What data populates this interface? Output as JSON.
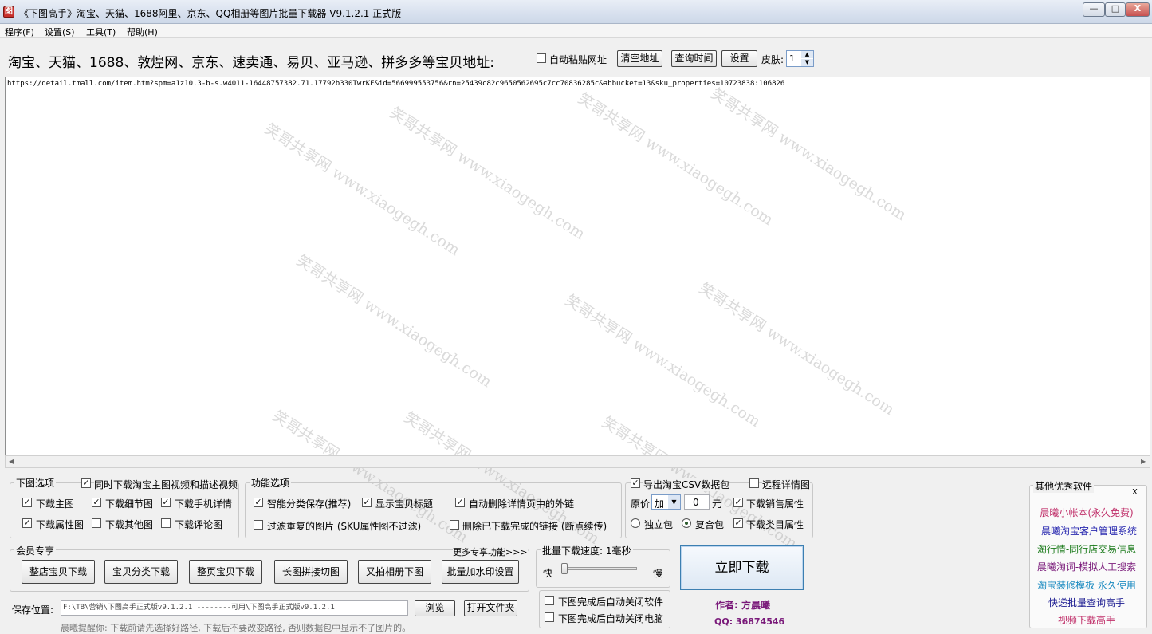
{
  "window": {
    "title": "《下图高手》淘宝、天猫、1688阿里、京东、QQ相册等图片批量下载器 V9.1.2.1 正式版",
    "icon_label": "图",
    "min": "—",
    "max": "□",
    "close": "X"
  },
  "menu": [
    "程序(F)",
    "设置(S)",
    "工具(T)",
    "帮助(H)"
  ],
  "toolbar": {
    "address_label": "淘宝、天猫、1688、敦煌网、京东、速卖通、易贝、亚马逊、拼多多等宝贝地址:",
    "auto_paste": "自动粘贴网址",
    "clear_btn": "清空地址",
    "query_time_btn": "查询时间",
    "settings_btn": "设置",
    "skin_label": "皮肤:",
    "skin_value": "1"
  },
  "url_text": "https://detail.tmall.com/item.htm?spm=a1z10.3-b-s.w4011-16448757382.71.17792b330TwrKF&id=566999553756&rn=25439c82c9650562695c7cc70836285c&abbucket=13&sku_properties=10723838:106826",
  "watermark": "笑哥共享网 www.xiaogegh.com",
  "download_options": {
    "title": "下图选项",
    "video_label": "同时下载淘宝主图视频和描述视频",
    "items": [
      {
        "label": "下载主图",
        "checked": true
      },
      {
        "label": "下载细节图",
        "checked": true
      },
      {
        "label": "下载手机详情",
        "checked": true
      },
      {
        "label": "下载属性图",
        "checked": true
      },
      {
        "label": "下载其他图",
        "checked": false
      },
      {
        "label": "下载评论图",
        "checked": false
      }
    ]
  },
  "features": {
    "title": "功能选项",
    "items": [
      {
        "label": "智能分类保存(推荐)",
        "checked": true
      },
      {
        "label": "显示宝贝标题",
        "checked": true
      },
      {
        "label": "自动删除详情页中的外链",
        "checked": true
      },
      {
        "label": "过滤重复的图片 (SKU属性图不过滤)",
        "checked": false
      },
      {
        "label": "删除已下载完成的链接 (断点续传)",
        "checked": false
      }
    ]
  },
  "csv": {
    "export_label": "导出淘宝CSV数据包",
    "remote_label": "远程详情图",
    "price_label": "原价",
    "price_op": "加",
    "price_value": "0",
    "unit": "元",
    "sales_attr": "下载销售属性",
    "pkg_single": "独立包",
    "pkg_combined": "复合包",
    "category_attr": "下载类目属性"
  },
  "vip": {
    "title": "会员专享",
    "more": "更多专享功能>>>",
    "buttons": [
      "整店宝贝下载",
      "宝贝分类下载",
      "整页宝贝下载",
      "长图拼接切图",
      "又拍相册下图",
      "批量加水印设置"
    ]
  },
  "speed": {
    "title": "批量下载速度: 1毫秒",
    "fast": "快",
    "slow": "慢",
    "slider_fraction": 0.0
  },
  "after": {
    "close_app": "下图完成后自动关闭软件",
    "shutdown": "下图完成后自动关闭电脑"
  },
  "download_btn": "立即下载",
  "author": {
    "name": "作者: 方晨曦",
    "qq": "QQ: 36874546"
  },
  "save": {
    "label": "保存位置:",
    "path": "F:\\TB\\营销\\下图高手正式版v9.1.2.1 --------可用\\下图高手正式版v9.1.2.1",
    "browse": "浏览",
    "open_folder": "打开文件夹",
    "hint": "晨曦提醒你: 下载前请先选择好路径, 下载后不要改变路径, 否则数据包中显示不了图片的。"
  },
  "other_software": {
    "title": "其他优秀软件",
    "close": "X",
    "items": [
      {
        "label": "晨曦小帐本(永久免费)",
        "color": "#c0306a"
      },
      {
        "label": "晨曦淘宝客户管理系统",
        "color": "#2a2ab0"
      },
      {
        "label": "淘行情-同行店交易信息",
        "color": "#1a7a1a"
      },
      {
        "label": "晨曦淘词-模拟人工搜索",
        "color": "#7a1a7a"
      },
      {
        "label": "淘宝装修模板 永久使用",
        "color": "#1a8ac0"
      },
      {
        "label": "快递批量查询高手",
        "color": "#1a1a90"
      },
      {
        "label": "视频下载高手",
        "color": "#c0306a"
      }
    ]
  }
}
